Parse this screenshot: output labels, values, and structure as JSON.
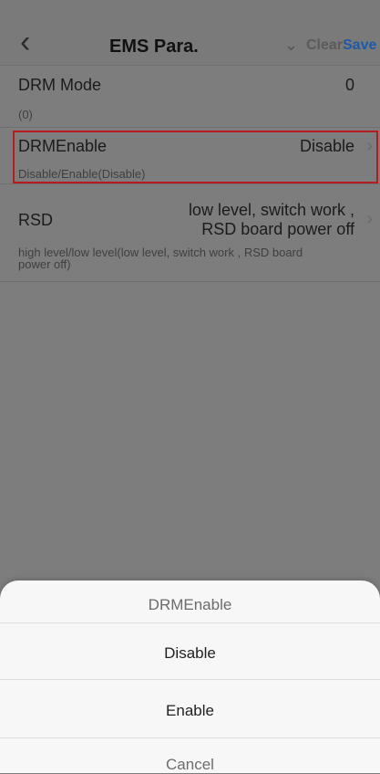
{
  "header": {
    "back_icon": "chevron-left-icon",
    "title": "EMS Para.",
    "dropdown_icon": "chevron-down-icon",
    "clear_label": "Clear",
    "save_label": "Save"
  },
  "rows": [
    {
      "label": "DRM Mode",
      "value": "0",
      "description": "(0)"
    },
    {
      "label": "DRMEnable",
      "value": "Disable",
      "description": "Disable/Enable(Disable)",
      "selected": true
    },
    {
      "label": "RSD",
      "value_line1": "low level, switch work ,",
      "value_line2": "RSD board power off",
      "description_line1": "high level/low level(low level, switch work , RSD board",
      "description_line2": "power off)"
    }
  ],
  "sheet": {
    "title": "DRMEnable",
    "options": [
      "Disable",
      "Enable"
    ],
    "cancel_label": "Cancel"
  },
  "colors": {
    "accent": "#1e5aa8",
    "highlight_border": "#b71c1c"
  }
}
